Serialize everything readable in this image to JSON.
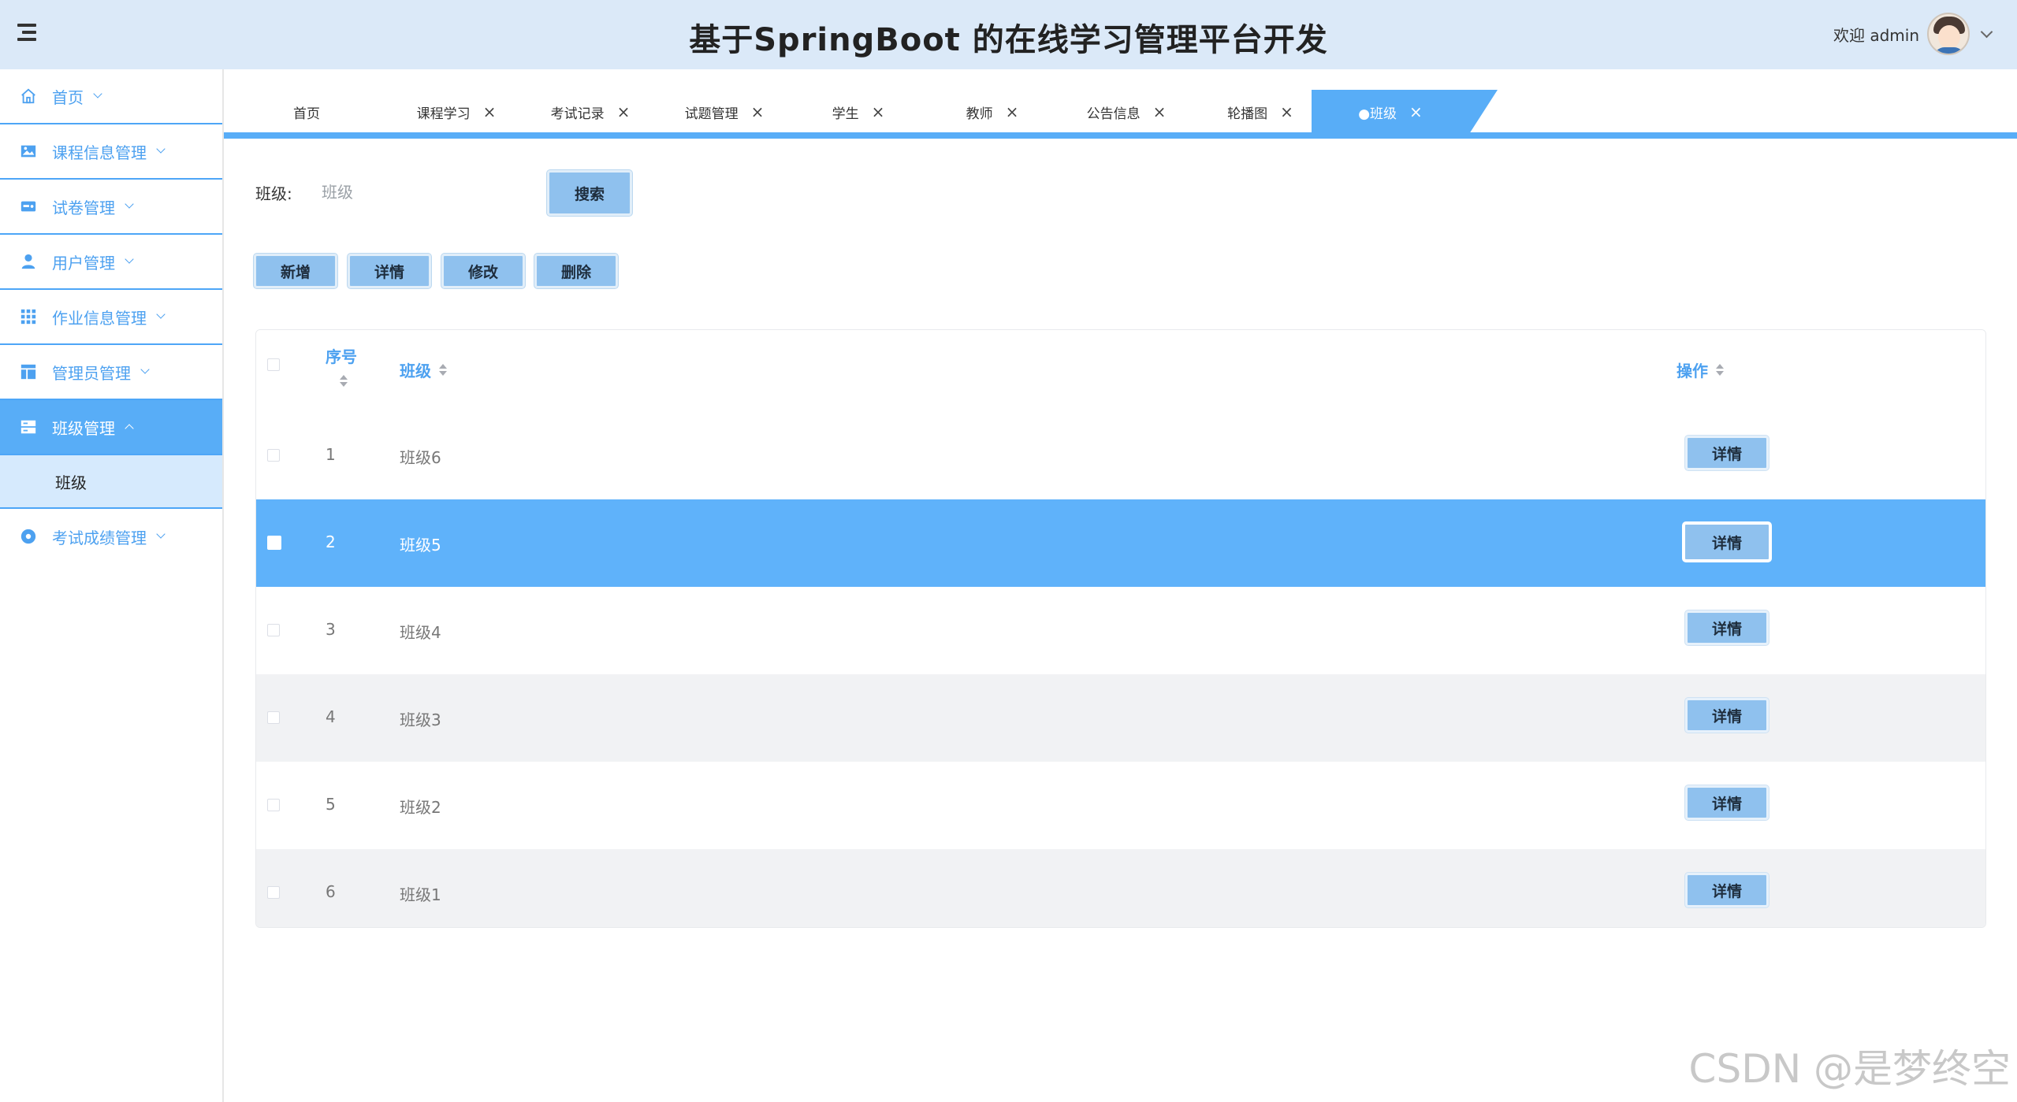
{
  "header": {
    "title": "基于SpringBoot 的在线学习管理平台开发",
    "welcome": "欢迎 admin"
  },
  "sidebar": {
    "items": [
      {
        "label": "首页",
        "icon": "home-icon"
      },
      {
        "label": "课程信息管理",
        "icon": "image-icon"
      },
      {
        "label": "试卷管理",
        "icon": "card-icon"
      },
      {
        "label": "用户管理",
        "icon": "user-icon"
      },
      {
        "label": "作业信息管理",
        "icon": "grid-icon"
      },
      {
        "label": "管理员管理",
        "icon": "layout-icon"
      },
      {
        "label": "班级管理",
        "icon": "server-icon",
        "active": true
      },
      {
        "label": "考试成绩管理",
        "icon": "circle-icon"
      }
    ],
    "subitems": [
      {
        "label": "班级"
      }
    ]
  },
  "tabs": [
    {
      "label": "首页",
      "closable": false
    },
    {
      "label": "课程学习",
      "closable": true
    },
    {
      "label": "考试记录",
      "closable": true
    },
    {
      "label": "试题管理",
      "closable": true
    },
    {
      "label": "学生",
      "closable": true
    },
    {
      "label": "教师",
      "closable": true
    },
    {
      "label": "公告信息",
      "closable": true
    },
    {
      "label": "轮播图",
      "closable": true
    },
    {
      "label": "●班级",
      "closable": true,
      "active": true
    }
  ],
  "tab_close_glyph": "×",
  "search": {
    "label": "班级:",
    "placeholder": "班级",
    "button": "搜索"
  },
  "toolbar": {
    "add": "新增",
    "detail": "详情",
    "edit": "修改",
    "delete": "删除"
  },
  "table": {
    "columns": {
      "seq": "序号",
      "name": "班级",
      "ops": "操作"
    },
    "rows": [
      {
        "seq": "1",
        "name": "班级6",
        "action": "详情"
      },
      {
        "seq": "2",
        "name": "班级5",
        "action": "详情",
        "highlighted": true
      },
      {
        "seq": "3",
        "name": "班级4",
        "action": "详情"
      },
      {
        "seq": "4",
        "name": "班级3",
        "action": "详情"
      },
      {
        "seq": "5",
        "name": "班级2",
        "action": "详情"
      },
      {
        "seq": "6",
        "name": "班级1",
        "action": "详情"
      }
    ]
  },
  "watermark": "CSDN @是梦终空",
  "colors": {
    "accent": "#58adf7",
    "header_bg": "#dbe9f8",
    "button": "#8fc1ee",
    "row_highlight": "#5fb2fa"
  }
}
